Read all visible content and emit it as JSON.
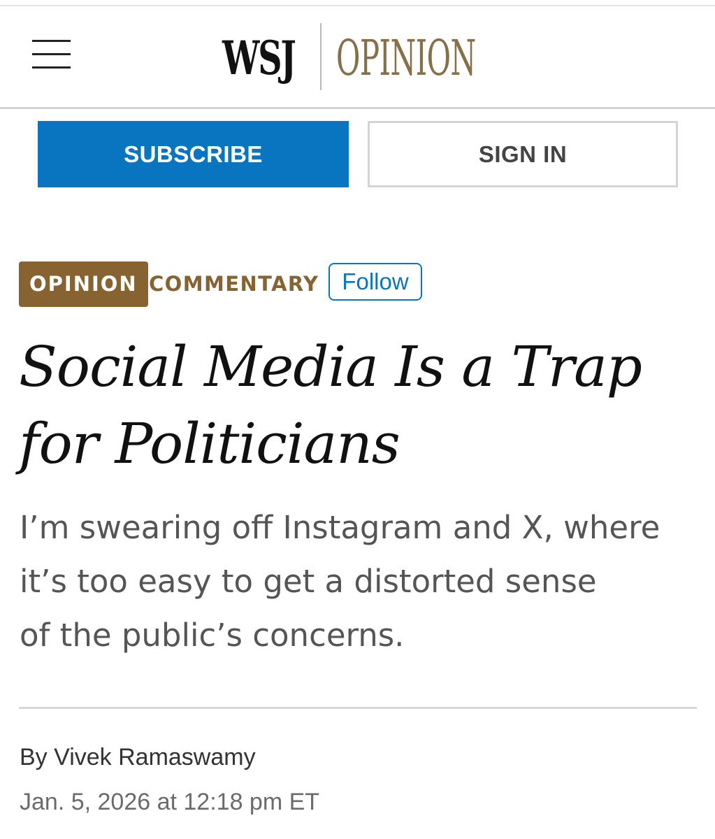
{
  "header": {
    "menu_icon": "hamburger-menu-icon",
    "logo": {
      "wsj": "WSJ",
      "section": "OPINION"
    }
  },
  "auth": {
    "subscribe_label": "SUBSCRIBE",
    "signin_label": "SIGN IN"
  },
  "tags": {
    "section": "OPINION",
    "category": "COMMENTARY",
    "follow_label": "Follow"
  },
  "article": {
    "headline_line1": "Social Media Is a Trap",
    "headline_line2": "for Politicians",
    "dek_line1": "I’m swearing off Instagram and X, where",
    "dek_line2": "it’s too easy to get a distorted sense",
    "dek_line3": "of the public’s concerns.",
    "byline_prefix": "By",
    "author": "Vivek Ramaswamy",
    "timestamp": "Jan. 5, 2026 at 12:18 pm ET"
  },
  "colors": {
    "subscribe_bg": "#0974c0",
    "opinion_tag_bg": "#876332",
    "logo_opinion": "#86704a",
    "follow_border": "#0974c0"
  }
}
